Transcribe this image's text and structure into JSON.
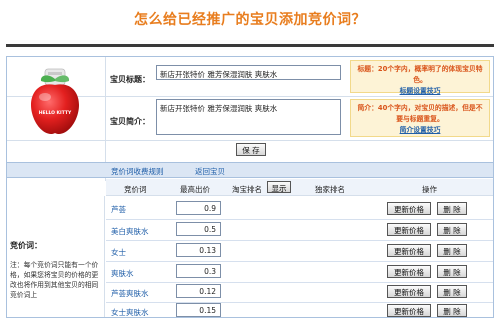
{
  "page": {
    "title": "怎么给已经推广的宝贝添加竞价词？"
  },
  "form": {
    "title_label": "宝贝标题：",
    "title_value": "新店开张特价 雅芳保湿润肤 爽肤水",
    "desc_label": "宝贝简介：",
    "desc_value": "新店开张特价 雅芳保湿润肤 爽肤水",
    "title_tip_text": "标题：20个字内，概率明了的体现宝贝特色。",
    "title_tip_link": "标题设置技巧",
    "desc_tip_text": "简介：40个字内，对宝贝的描述，但是不要与标题重复。",
    "desc_tip_link": "简介设置技巧",
    "save_label": "保 存"
  },
  "tabs": {
    "fee_rule": "竞价词收费规则",
    "back": "返回宝贝"
  },
  "table": {
    "headers": {
      "keyword": "竞价词",
      "max_bid": "最高出价",
      "rank": "淘宝排名",
      "show": "显示",
      "exclusive": "独家排名",
      "action": "操作"
    },
    "update_label": "更新价格",
    "delete_label": "删 除",
    "rows": [
      {
        "keyword": "芦荟",
        "bid": "0.9"
      },
      {
        "keyword": "美白爽肤水",
        "bid": "0.5"
      },
      {
        "keyword": "女士",
        "bid": "0.13"
      },
      {
        "keyword": "爽肤水",
        "bid": "0.3"
      },
      {
        "keyword": "芦荟爽肤水",
        "bid": "0.12"
      },
      {
        "keyword": "女士爽肤水",
        "bid": "0.15"
      }
    ]
  },
  "left_panel": {
    "title": "竞价词：",
    "note": "注：每个竞价词只能有一个价格，如果您将宝贝的价格的更改也将作用到其他宝贝的相同竞价词上"
  },
  "product_image": {
    "icon": "apple-box-product-image",
    "brand_text": "HELLO KITTY"
  }
}
